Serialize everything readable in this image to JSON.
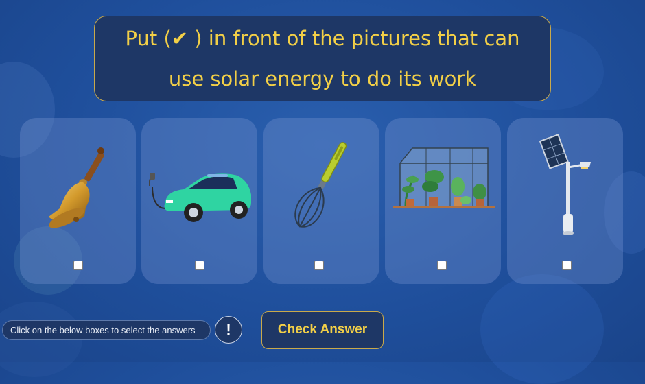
{
  "question": {
    "text": "Put (✔ ) in front of the pictures that can use solar energy to do its work"
  },
  "cards": [
    {
      "image": "bell-icon",
      "checked": false
    },
    {
      "image": "electric-car-icon",
      "checked": false
    },
    {
      "image": "whisk-icon",
      "checked": false
    },
    {
      "image": "greenhouse-icon",
      "checked": false
    },
    {
      "image": "solar-street-light-icon",
      "checked": false
    }
  ],
  "footer": {
    "hint": "Click on the below boxes to select the answers",
    "info_symbol": "!",
    "check_label": "Check Answer"
  },
  "colors": {
    "background": "#1f4f9c",
    "panel": "#1e3766",
    "accent": "#f2cf47",
    "border": "#c9a94a"
  }
}
